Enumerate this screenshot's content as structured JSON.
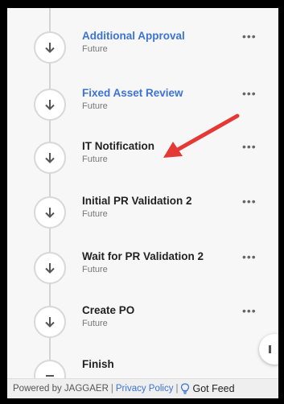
{
  "steps": [
    {
      "title": "Additional Approval",
      "status": "Future",
      "link": true
    },
    {
      "title": "Fixed Asset Review",
      "status": "Future",
      "link": true
    },
    {
      "title": "IT Notification",
      "status": "Future",
      "link": false
    },
    {
      "title": "Initial PR Validation 2",
      "status": "Future",
      "link": false
    },
    {
      "title": "Wait for PR Validation 2",
      "status": "Future",
      "link": false
    },
    {
      "title": "Create PO",
      "status": "Future",
      "link": false
    },
    {
      "title": "Finish",
      "status": "",
      "link": false
    }
  ],
  "menu_glyph": "•••",
  "footer": {
    "powered": "Powered by JAGGAER",
    "privacy": "Privacy Policy",
    "feedback": "Got Feed"
  },
  "colors": {
    "link": "#3b73d6",
    "arrow": "#e53935"
  }
}
